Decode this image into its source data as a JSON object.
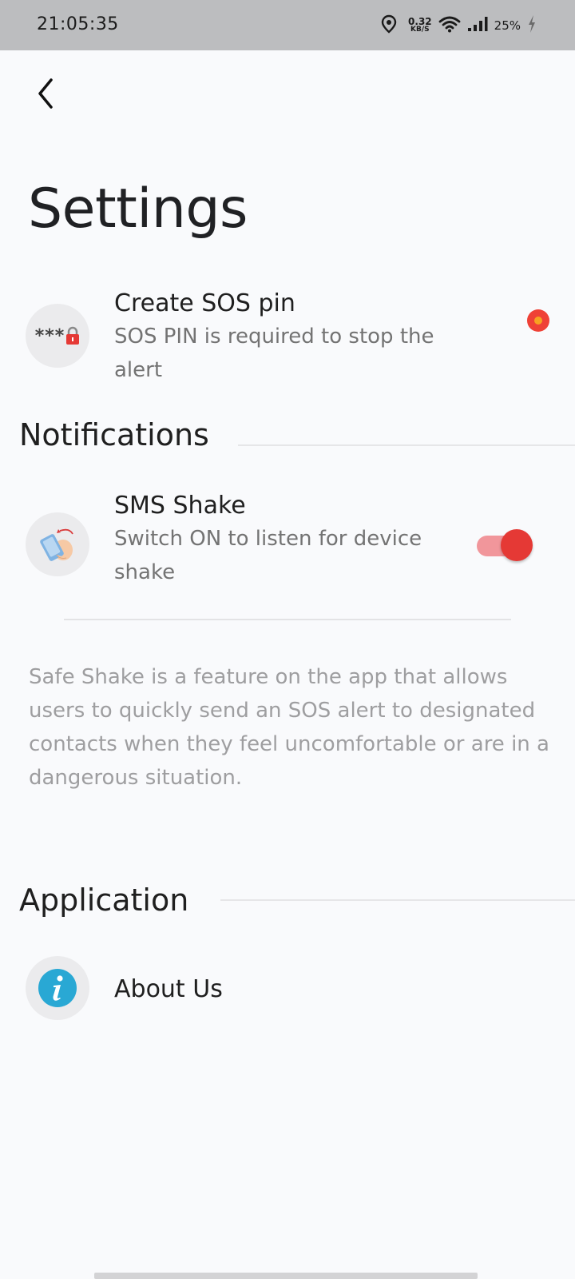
{
  "status_bar": {
    "time": "21:05:35",
    "net_speed_value": "0.32",
    "net_speed_unit": "KB/S",
    "battery": "25%"
  },
  "page": {
    "title": "Settings"
  },
  "sos_pin": {
    "title": "Create SOS pin",
    "description": "SOS PIN is required to stop the alert",
    "icon_text": "***",
    "status_color": "#ef4136"
  },
  "notifications": {
    "header": "Notifications",
    "sms_shake": {
      "title": "SMS Shake",
      "description": "Switch ON to listen for device shake",
      "enabled": true
    },
    "info_text": "Safe Shake is a feature on the app that allows users to quickly send an SOS alert to designated contacts when they feel uncomfortable or are in a dangerous situation."
  },
  "application": {
    "header": "Application",
    "about": {
      "title": "About Us"
    }
  },
  "colors": {
    "accent": "#e53935",
    "info_icon": "#29a8d4",
    "background": "#f9fafc"
  }
}
